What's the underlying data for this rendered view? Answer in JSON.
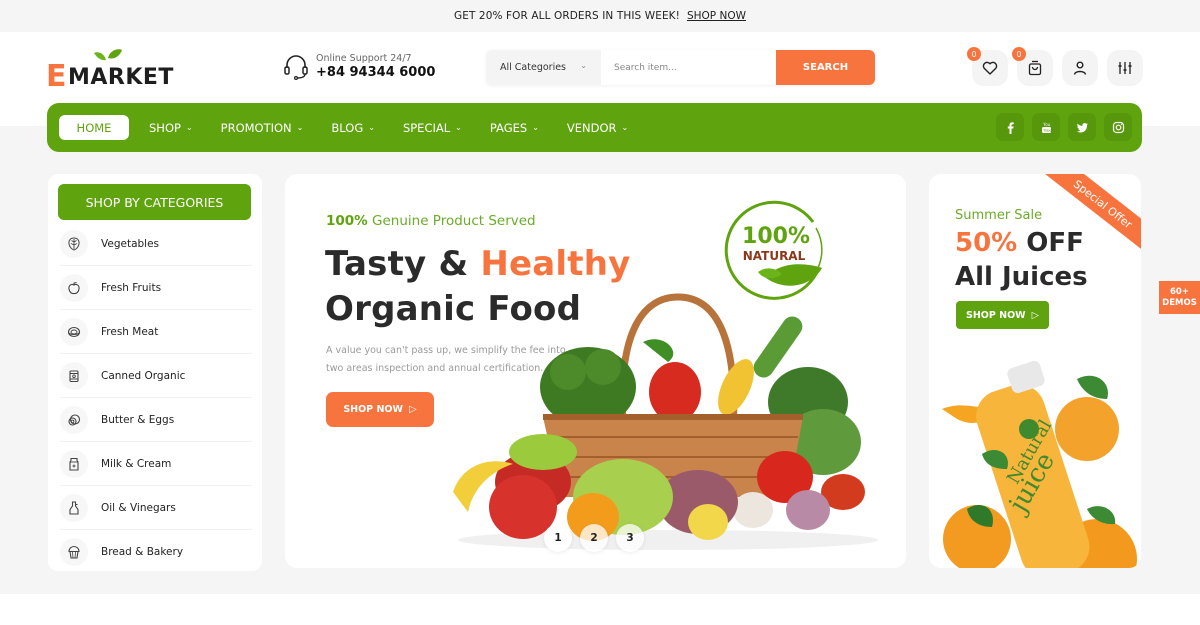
{
  "topbar": {
    "promo_text": "GET 20% FOR ALL ORDERS IN THIS WEEK!",
    "shop_link": "SHOP NOW"
  },
  "header": {
    "logo_text": "EMARKET",
    "support": {
      "label": "Online Support 24/7",
      "phone": "+84 94344 6000",
      "icon": "headset-icon"
    },
    "search": {
      "category_selected": "All Categories",
      "placeholder": "Search item...",
      "button_label": "SEARCH"
    },
    "actions": [
      {
        "name": "wishlist",
        "icon": "heart-icon",
        "badge": "0"
      },
      {
        "name": "cart",
        "icon": "shopping-bag-icon",
        "badge": "0"
      },
      {
        "name": "account",
        "icon": "user-icon"
      },
      {
        "name": "compare",
        "icon": "sliders-icon"
      }
    ]
  },
  "nav": {
    "items": [
      {
        "label": "HOME",
        "active": true
      },
      {
        "label": "SHOP",
        "dropdown": true
      },
      {
        "label": "PROMOTION",
        "dropdown": true
      },
      {
        "label": "BLOG",
        "dropdown": true
      },
      {
        "label": "SPECIAL",
        "dropdown": true
      },
      {
        "label": "PAGES",
        "dropdown": true
      },
      {
        "label": "VENDOR",
        "dropdown": true
      }
    ],
    "social": [
      "facebook-icon",
      "youtube-icon",
      "twitter-icon",
      "instagram-icon"
    ]
  },
  "sidebar": {
    "title": "SHOP BY CATEGORIES",
    "items": [
      {
        "label": "Vegetables",
        "icon": "vegetable-icon"
      },
      {
        "label": "Fresh Fruits",
        "icon": "apple-icon"
      },
      {
        "label": "Fresh Meat",
        "icon": "meat-icon"
      },
      {
        "label": "Canned Organic",
        "icon": "can-icon"
      },
      {
        "label": "Butter & Eggs",
        "icon": "egg-icon"
      },
      {
        "label": "Milk & Cream",
        "icon": "milk-carton-icon"
      },
      {
        "label": "Oil & Vinegars",
        "icon": "oil-bottle-icon"
      },
      {
        "label": "Bread & Bakery",
        "icon": "cupcake-icon"
      }
    ]
  },
  "hero": {
    "tag_strong": "100%",
    "tag_rest": " Genuine Product Served",
    "title_part1": "Tasty & ",
    "title_highlight": "Healthy",
    "title_line2": "Organic Food",
    "description": "A value you can't pass up, we simplify the fee into two areas inspection and annual certification.",
    "cta_label": "SHOP NOW",
    "badge_line1": "100%",
    "badge_line2": "NATURAL",
    "slides": [
      "1",
      "2",
      "3"
    ],
    "active_slide": 1
  },
  "promo": {
    "ribbon": "Special Offer",
    "subtitle": "Summer Sale",
    "percent": "50%",
    "off": " OFF",
    "line2": "All Juices",
    "cta_label": "SHOP NOW",
    "bottle_text1": "Natural",
    "bottle_text2": "juice"
  },
  "demos": {
    "line1": "60+",
    "line2": "DEMOS"
  },
  "colors": {
    "brand_green": "#5fa30f",
    "accent_orange": "#f8743f",
    "text_dark": "#2b2b2b"
  }
}
